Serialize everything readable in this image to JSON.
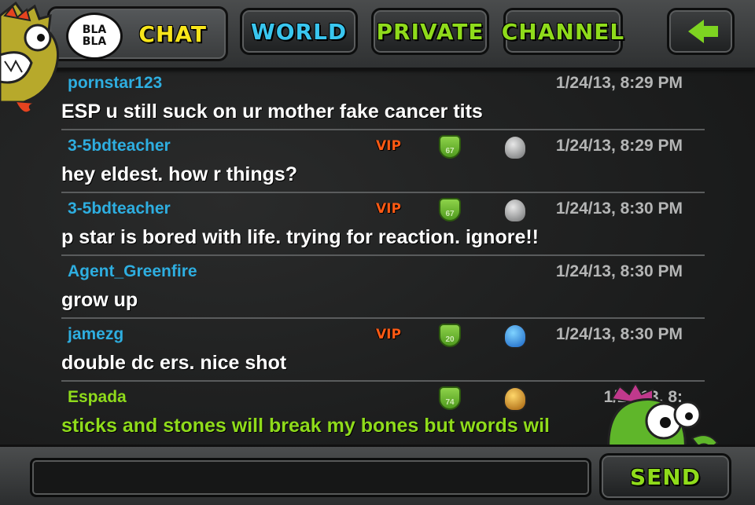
{
  "header": {
    "bubble_line1": "BLA",
    "bubble_line2": "BLA",
    "tabs": [
      {
        "label": "CHAT"
      },
      {
        "label": "WORLD"
      },
      {
        "label": "PRIVATE"
      },
      {
        "label": "CHANNEL"
      }
    ],
    "back_icon": "back-arrow-icon"
  },
  "colors": {
    "chat_tab": "#f7e51b",
    "world_tab": "#39c6ef",
    "green_accent": "#8fdb1b",
    "username": "#2eaee0",
    "vip": "#ff5a14"
  },
  "messages": [
    {
      "user": "pornstar123",
      "time": "1/24/13, 8:29 PM",
      "text": "ESP u still suck on ur mother fake cancer tits"
    },
    {
      "user": "3-5bdteacher",
      "vip": "VIP",
      "level": "67",
      "rank_icon": "silver-rank-icon",
      "time": "1/24/13, 8:29 PM",
      "text": "hey eldest. how r things?"
    },
    {
      "user": "3-5bdteacher",
      "vip": "VIP",
      "level": "67",
      "rank_icon": "silver-rank-icon",
      "time": "1/24/13, 8:30 PM",
      "text": "p star is bored with life.  trying for reaction.  ignore!!"
    },
    {
      "user": "Agent_Greenfire",
      "time": "1/24/13, 8:30 PM",
      "text": "grow up"
    },
    {
      "user": "jamezg",
      "vip": "VIP",
      "level": "20",
      "rank_icon": "blue-rank-icon",
      "time": "1/24/13, 8:30 PM",
      "text": "double dc ers.  nice shot"
    },
    {
      "user": "Espada",
      "level": "74",
      "rank_icon": "gold-rank-icon",
      "time": "1/24/13, 8:",
      "text": "sticks and stones will break my bones but words wil"
    }
  ],
  "footer": {
    "input_value": "",
    "input_placeholder": "",
    "send_label": "SEND"
  }
}
